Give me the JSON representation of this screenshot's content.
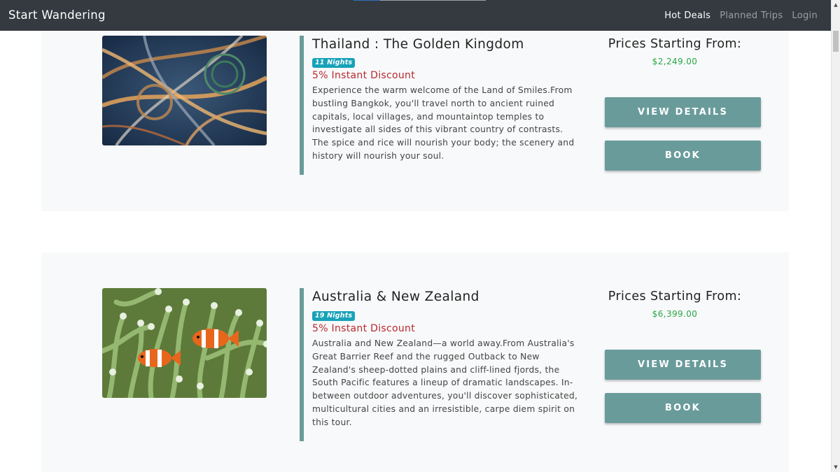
{
  "navbar": {
    "brand": "Start Wandering",
    "links": [
      {
        "label": "Hot Deals",
        "active": true
      },
      {
        "label": "Planned Trips",
        "active": false
      },
      {
        "label": "Login",
        "active": false
      }
    ],
    "scroll_progress_fraction": 0.2
  },
  "button_labels": {
    "view_details": "VIEW DETAILS",
    "book": "BOOK"
  },
  "trips": [
    {
      "title": "Thailand : The Golden Kingdom",
      "nights": "11 Nights",
      "discount": "5% Instant Discount",
      "description": "Experience the warm welcome of the Land of Smiles.From bustling Bangkok, you'll travel north to ancient ruined capitals, local villages, and mountaintop temples to investigate all sides of this vibrant country of contrasts. The spice and rice will nourish your body; the scenery and history will nourish your soul.",
      "price_label": "Prices Starting From:",
      "price": "$2,249.00",
      "image": "highway-interchange-aerial"
    },
    {
      "title": "Australia & New Zealand",
      "nights": "19 Nights",
      "discount": "5% Instant Discount",
      "description": "Australia and New Zealand—a world away.From Australia's Great Barrier Reef and the rugged Outback to New Zealand's sheep-dotted plains and cliff-lined fjords, the South Pacific features a lineup of dramatic landscapes. In-between outdoor adventures, you'll discover sophisticated, multicultural cities and an irresistible, carpe diem spirit on this tour.",
      "price_label": "Prices Starting From:",
      "price": "$6,399.00",
      "image": "clownfish-anemone"
    }
  ],
  "colors": {
    "navbar": "#343a40",
    "card_bg": "#f8f9fa",
    "accent": "#6a9b9b",
    "badge": "#17a2b8",
    "discount": "#b8292f",
    "price": "#28a745"
  }
}
